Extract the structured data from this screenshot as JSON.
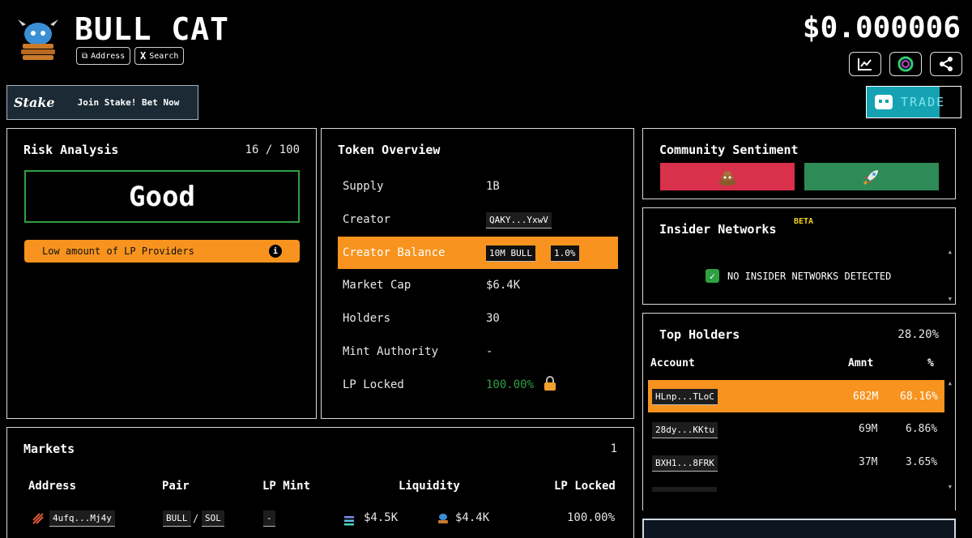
{
  "token": {
    "name": "BULL CAT",
    "price": "$0.000006",
    "address_btn": "Address",
    "search_btn": "Search"
  },
  "stake": {
    "logo": "Stake",
    "text": "Join Stake! Bet Now"
  },
  "trade": {
    "label": "TRADE"
  },
  "risk": {
    "title": "Risk Analysis",
    "score": "16 / 100",
    "rating": "Good",
    "warning": "Low amount of LP Providers"
  },
  "overview": {
    "title": "Token Overview",
    "rows": [
      {
        "label": "Supply",
        "value": "1B"
      },
      {
        "label": "Creator",
        "value": "QAKY...YxwV"
      },
      {
        "label": "Creator Balance",
        "value": "10M BULL",
        "value2": "1.0%"
      },
      {
        "label": "Market Cap",
        "value": "$6.4K"
      },
      {
        "label": "Holders",
        "value": "30"
      },
      {
        "label": "Mint Authority",
        "value": "-"
      },
      {
        "label": "LP Locked",
        "value": "100.00%"
      }
    ]
  },
  "sentiment": {
    "title": "Community Sentiment",
    "bad_color": "#d9304b",
    "good_color": "#2e8b57"
  },
  "insider": {
    "title": "Insider Networks",
    "badge": "BETA",
    "status": "NO INSIDER NETWORKS DETECTED"
  },
  "holders": {
    "title": "Top Holders",
    "total": "28.20%",
    "headers": [
      "Account",
      "Amnt",
      "%"
    ],
    "rows": [
      {
        "account": "HLnp...TLoC",
        "amount": "682M",
        "pct": "68.16%"
      },
      {
        "account": "28dy...KKtu",
        "amount": "69M",
        "pct": "6.86%"
      },
      {
        "account": "BXH1...8FRK",
        "amount": "37M",
        "pct": "3.65%"
      }
    ]
  },
  "markets": {
    "title": "Markets",
    "count": "1",
    "headers": [
      "Address",
      "Pair",
      "LP Mint",
      "Liquidity",
      "LP Locked"
    ],
    "row": {
      "address": "4ufq...Mj4y",
      "pair_a": "BULL",
      "pair_sep": "/",
      "pair_b": "SOL",
      "lp_mint": "-",
      "liq1": "$4.5K",
      "liq2": "$4.4K",
      "locked": "100.00%"
    }
  },
  "colors": {
    "accent": "#f7931e",
    "green": "#2ea043"
  }
}
